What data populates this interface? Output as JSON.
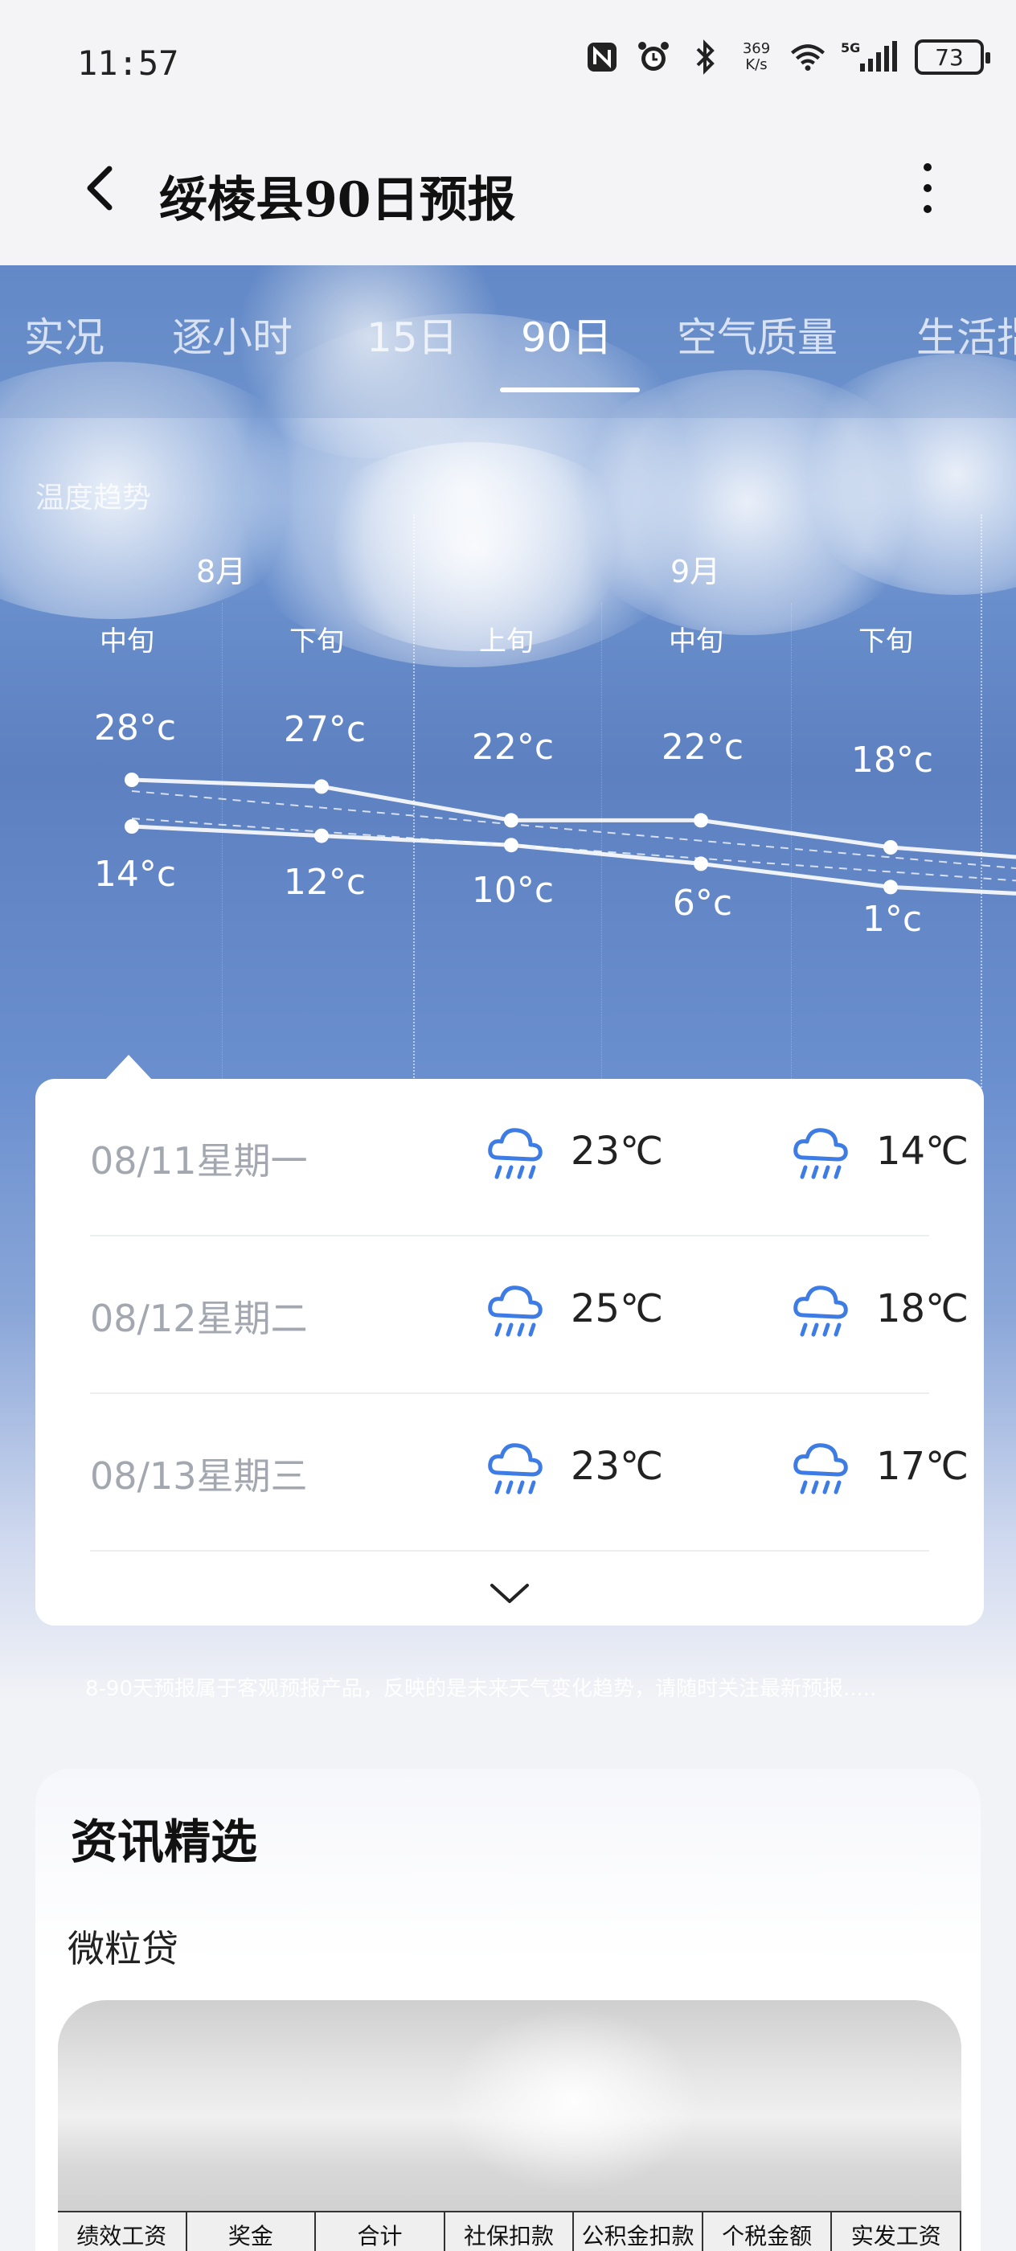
{
  "status_bar": {
    "time": "11:57",
    "speed_top": "369",
    "speed_bottom": "K/s",
    "network": "5G",
    "battery": "73",
    "icons": [
      "nfc-icon",
      "alarm-icon",
      "bluetooth-icon",
      "wifi-icon",
      "signal-icon",
      "battery-icon"
    ]
  },
  "header": {
    "title": "绥棱县90日预报"
  },
  "tabs": [
    {
      "label": "实况"
    },
    {
      "label": "逐小时"
    },
    {
      "label": "15日"
    },
    {
      "label": "90日"
    },
    {
      "label": "空气质量"
    },
    {
      "label": "生活指"
    }
  ],
  "active_tab": "90日",
  "trend": {
    "label": "温度趋势",
    "months": [
      "8月",
      "9月"
    ],
    "periods": [
      "中旬",
      "下旬",
      "上旬",
      "中旬",
      "下旬"
    ],
    "highs": [
      "28°c",
      "27°c",
      "22°c",
      "22°c",
      "18°c"
    ],
    "lows": [
      "14°c",
      "12°c",
      "10°c",
      "6°c",
      "1°c"
    ]
  },
  "chart_data": {
    "type": "line",
    "categories": [
      "8月中旬",
      "8月下旬",
      "9月上旬",
      "9月中旬",
      "9月下旬"
    ],
    "series": [
      {
        "values": [
          28,
          27,
          22,
          22,
          18
        ]
      },
      {
        "values": [
          14,
          12,
          10,
          6,
          1
        ]
      }
    ]
  },
  "days": [
    {
      "date": "08/11星期一",
      "day_temp": "23℃",
      "night_temp": "14℃",
      "icon": "rain-icon"
    },
    {
      "date": "08/12星期二",
      "day_temp": "25℃",
      "night_temp": "18℃",
      "icon": "rain-icon"
    },
    {
      "date": "08/13星期三",
      "day_temp": "23℃",
      "night_temp": "17℃",
      "icon": "rain-icon"
    }
  ],
  "note": "8-90天预报属于客观预报产品，反映的是未来天气变化趋势，请随时关注最新预报.....",
  "news": {
    "title": "资讯精选",
    "subtitle": "微粒贷",
    "table_headers": [
      "绩效工资",
      "奖金",
      "合计",
      "社保扣款",
      "公积金扣款",
      "个税金额",
      "实发工资"
    ]
  },
  "colors": {
    "accent_icon": "#3d7be5",
    "sky_top": "#5b83c6"
  }
}
